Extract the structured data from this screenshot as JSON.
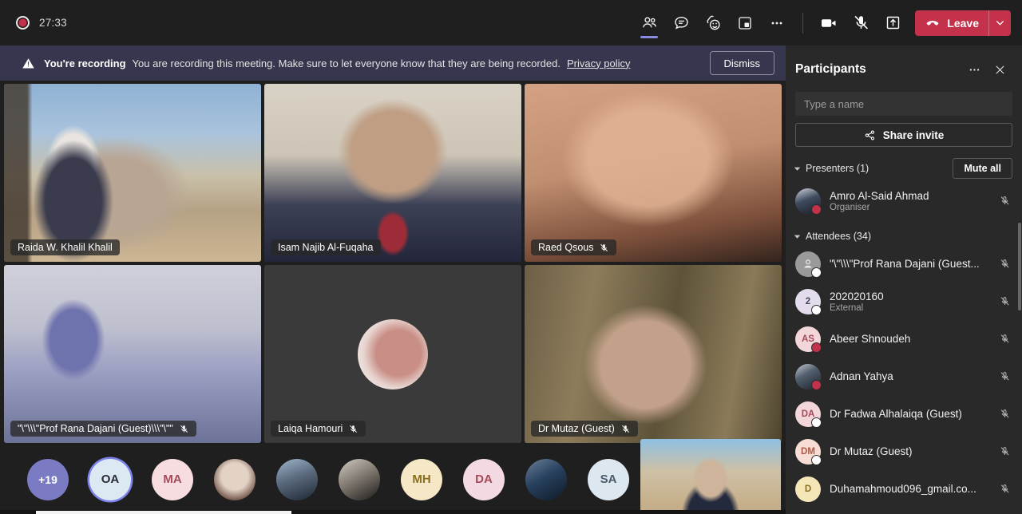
{
  "topbar": {
    "recording_time": "27:33",
    "recording_icon": "record-dot-icon",
    "buttons": [
      {
        "name": "people-icon",
        "label": "People",
        "active": true
      },
      {
        "name": "chat-icon",
        "label": "Chat",
        "active": false
      },
      {
        "name": "reactions-icon",
        "label": "Reactions",
        "active": false
      },
      {
        "name": "breakout-rooms-icon",
        "label": "Rooms",
        "active": false
      },
      {
        "name": "more-options-icon",
        "label": "More actions",
        "active": false
      }
    ],
    "camera_icon": "camera-icon",
    "mic_icon": "microphone-muted-icon",
    "share_icon": "share-screen-icon",
    "leave_label": "Leave",
    "leave_caret_icon": "chevron-down-icon"
  },
  "banner": {
    "warning_icon": "warning-triangle-icon",
    "strong": "You're recording",
    "text": "You are recording this meeting. Make sure to let everyone know that they are being recorded.",
    "link": "Privacy policy",
    "dismiss": "Dismiss"
  },
  "stage": {
    "tiles": [
      {
        "name": "Raida W. Khalil Khalil",
        "muted": false,
        "bg": "bg-raida",
        "avatar": false
      },
      {
        "name": "Isam Najib Al-Fuqaha",
        "muted": false,
        "bg": "bg-isam",
        "avatar": false
      },
      {
        "name": "Raed Qsous",
        "muted": true,
        "bg": "bg-raed",
        "avatar": false
      },
      {
        "name": "\"\\\"\\\\\\\"Prof Rana Dajani (Guest)\\\\\\\"\\\"\"",
        "muted": true,
        "bg": "bg-rana",
        "avatar": false
      },
      {
        "name": "Laiqa Hamouri",
        "muted": true,
        "bg": "bg-laiqa",
        "avatar": true
      },
      {
        "name": "Dr Mutaz (Guest)",
        "muted": true,
        "bg": "bg-mutaz",
        "avatar": false
      }
    ]
  },
  "filmstrip": {
    "items": [
      {
        "type": "overflow",
        "label": "+19",
        "name": "filmstrip-overflow-count"
      },
      {
        "type": "initials",
        "label": "OA",
        "speaking": true,
        "bg": "#dce8f2"
      },
      {
        "type": "initials",
        "label": "MA",
        "speaking": false,
        "bg": "#f7dce0"
      },
      {
        "type": "photo",
        "label": "",
        "photo": "fs-ph1"
      },
      {
        "type": "photo",
        "label": "",
        "photo": "fs-ph2"
      },
      {
        "type": "photo",
        "label": "",
        "photo": "fs-ph3"
      },
      {
        "type": "initials",
        "label": "MH",
        "speaking": false,
        "bg": "#f6e7c6"
      },
      {
        "type": "initials",
        "label": "DA",
        "speaking": false,
        "bg": "#f3dae2"
      },
      {
        "type": "photo",
        "label": "",
        "photo": "fs-ph4"
      },
      {
        "type": "initials",
        "label": "SA",
        "speaking": false,
        "bg": "#dde7ef"
      }
    ],
    "self_view_name": "self-video-tile"
  },
  "panel": {
    "title": "Participants",
    "more_icon": "more-options-icon",
    "close_icon": "close-icon",
    "search_placeholder": "Type a name",
    "share_invite_label": "Share invite",
    "share_invite_icon": "share-link-icon",
    "presenters_label": "Presenters (1)",
    "mute_all_label": "Mute all",
    "attendees_label": "Attendees (34)",
    "presenters": [
      {
        "name": "Amro Al-Said Ahmad",
        "sub": "Organiser",
        "initials": "",
        "photo": true,
        "avatar_bg": "#4a5b74",
        "presence": "busy",
        "muted": true
      }
    ],
    "attendees": [
      {
        "name": "\"\\\"\\\\\\\"Prof Rana Dajani (Guest...",
        "sub": "",
        "initials": "",
        "photo": false,
        "generic": true,
        "avatar_bg": "#9a9a9a",
        "presence": "away",
        "muted": true
      },
      {
        "name": "202020160",
        "sub": "External",
        "initials": "2",
        "photo": false,
        "avatar_bg": "#e3dced",
        "text_color": "#4a4257",
        "presence": "off",
        "muted": true
      },
      {
        "name": "Abeer Shnoudeh",
        "sub": "",
        "initials": "AS",
        "photo": false,
        "avatar_bg": "#f3d6da",
        "text_color": "#a34a58",
        "presence": "busy",
        "muted": true
      },
      {
        "name": "Adnan Yahya",
        "sub": "",
        "initials": "",
        "photo": true,
        "avatar_bg": "#5e6b52",
        "presence": "busy",
        "muted": true
      },
      {
        "name": "Dr Fadwa Alhalaiqa (Guest)",
        "sub": "",
        "initials": "DA",
        "photo": false,
        "avatar_bg": "#f3d6da",
        "text_color": "#a34a58",
        "presence": "away",
        "muted": true
      },
      {
        "name": "Dr Mutaz (Guest)",
        "sub": "",
        "initials": "DM",
        "photo": false,
        "avatar_bg": "#f7ddd4",
        "text_color": "#b05a46",
        "presence": "away",
        "muted": true
      },
      {
        "name": "Duhamahmoud096_gmail.co...",
        "sub": "",
        "initials": "D",
        "photo": false,
        "avatar_bg": "#f5e6b8",
        "text_color": "#8a6d1f",
        "presence": "away",
        "muted": true
      }
    ]
  },
  "colors": {
    "accent": "#7b83eb",
    "danger": "#c4314b",
    "banner_bg": "#36364e",
    "panel_bg": "#292929",
    "app_bg": "#1f1f1f"
  }
}
